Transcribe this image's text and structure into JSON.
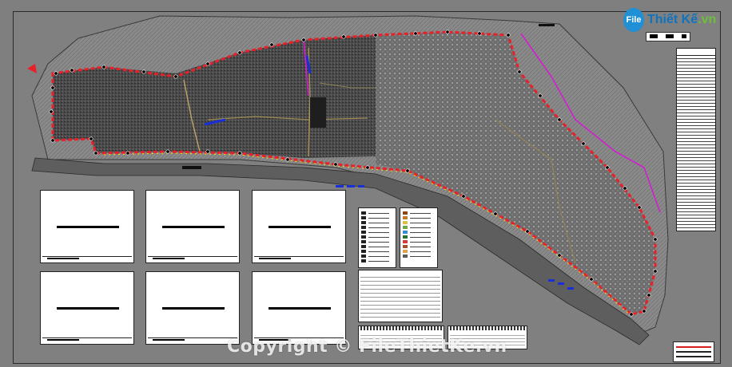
{
  "logo": {
    "mark": "File",
    "name_part1": "Thiết Kế",
    "name_part2": ".vn"
  },
  "watermark": {
    "text": "Copyright © FileThietKe.vn"
  },
  "colors": {
    "canvas": "#7f7f7f",
    "boundary": "#e8202a",
    "boundary_dash": "#ffe000",
    "magenta_line": "#d21ed2",
    "blue_marker": "#1a2fd8",
    "urban_fill": "#4a4a4a",
    "river_strip": "#5e5e5e"
  },
  "icons": {
    "north_arrow": "arrow-icon",
    "scale_bar": "scale-bar-icon"
  }
}
